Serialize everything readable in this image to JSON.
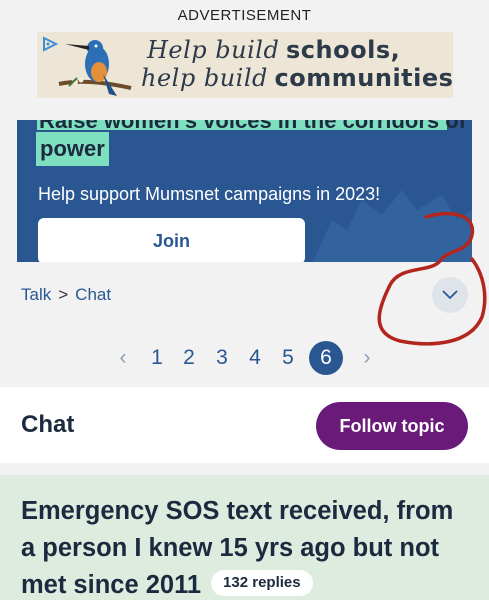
{
  "advertisement": {
    "label": "ADVERTISEMENT",
    "line1_script": "Help build",
    "line1_bold": "schools,",
    "line2_script": "help build",
    "line2_bold": "communities."
  },
  "campaign": {
    "headline_partial": "Raise women's voices in the corridors of",
    "headline_last": "power",
    "subtitle": "Help support Mumsnet campaigns in 2023!",
    "join_label": "Join"
  },
  "breadcrumb": {
    "items": [
      "Talk",
      "Chat"
    ],
    "separator": ">"
  },
  "pagination": {
    "prev": "‹",
    "next": "›",
    "pages": [
      "1",
      "2",
      "3",
      "4",
      "5",
      "6"
    ],
    "current": "6"
  },
  "topic": {
    "title": "Chat",
    "follow_label": "Follow topic"
  },
  "thread": {
    "title": "Emergency SOS text received, from a person I knew 15 yrs ago but not met since 2011",
    "replies": "132 replies"
  },
  "colors": {
    "brand_blue": "#2a5792",
    "highlight_mint": "#7fe0c0",
    "follow_purple": "#6a1b7a",
    "thread_bg": "#deecdf",
    "annotation_red": "#b3261e"
  },
  "icons": {
    "ad_choice": "ad-choices-icon",
    "bird": "kingfisher-illustration",
    "expand": "chevron-down-icon"
  }
}
